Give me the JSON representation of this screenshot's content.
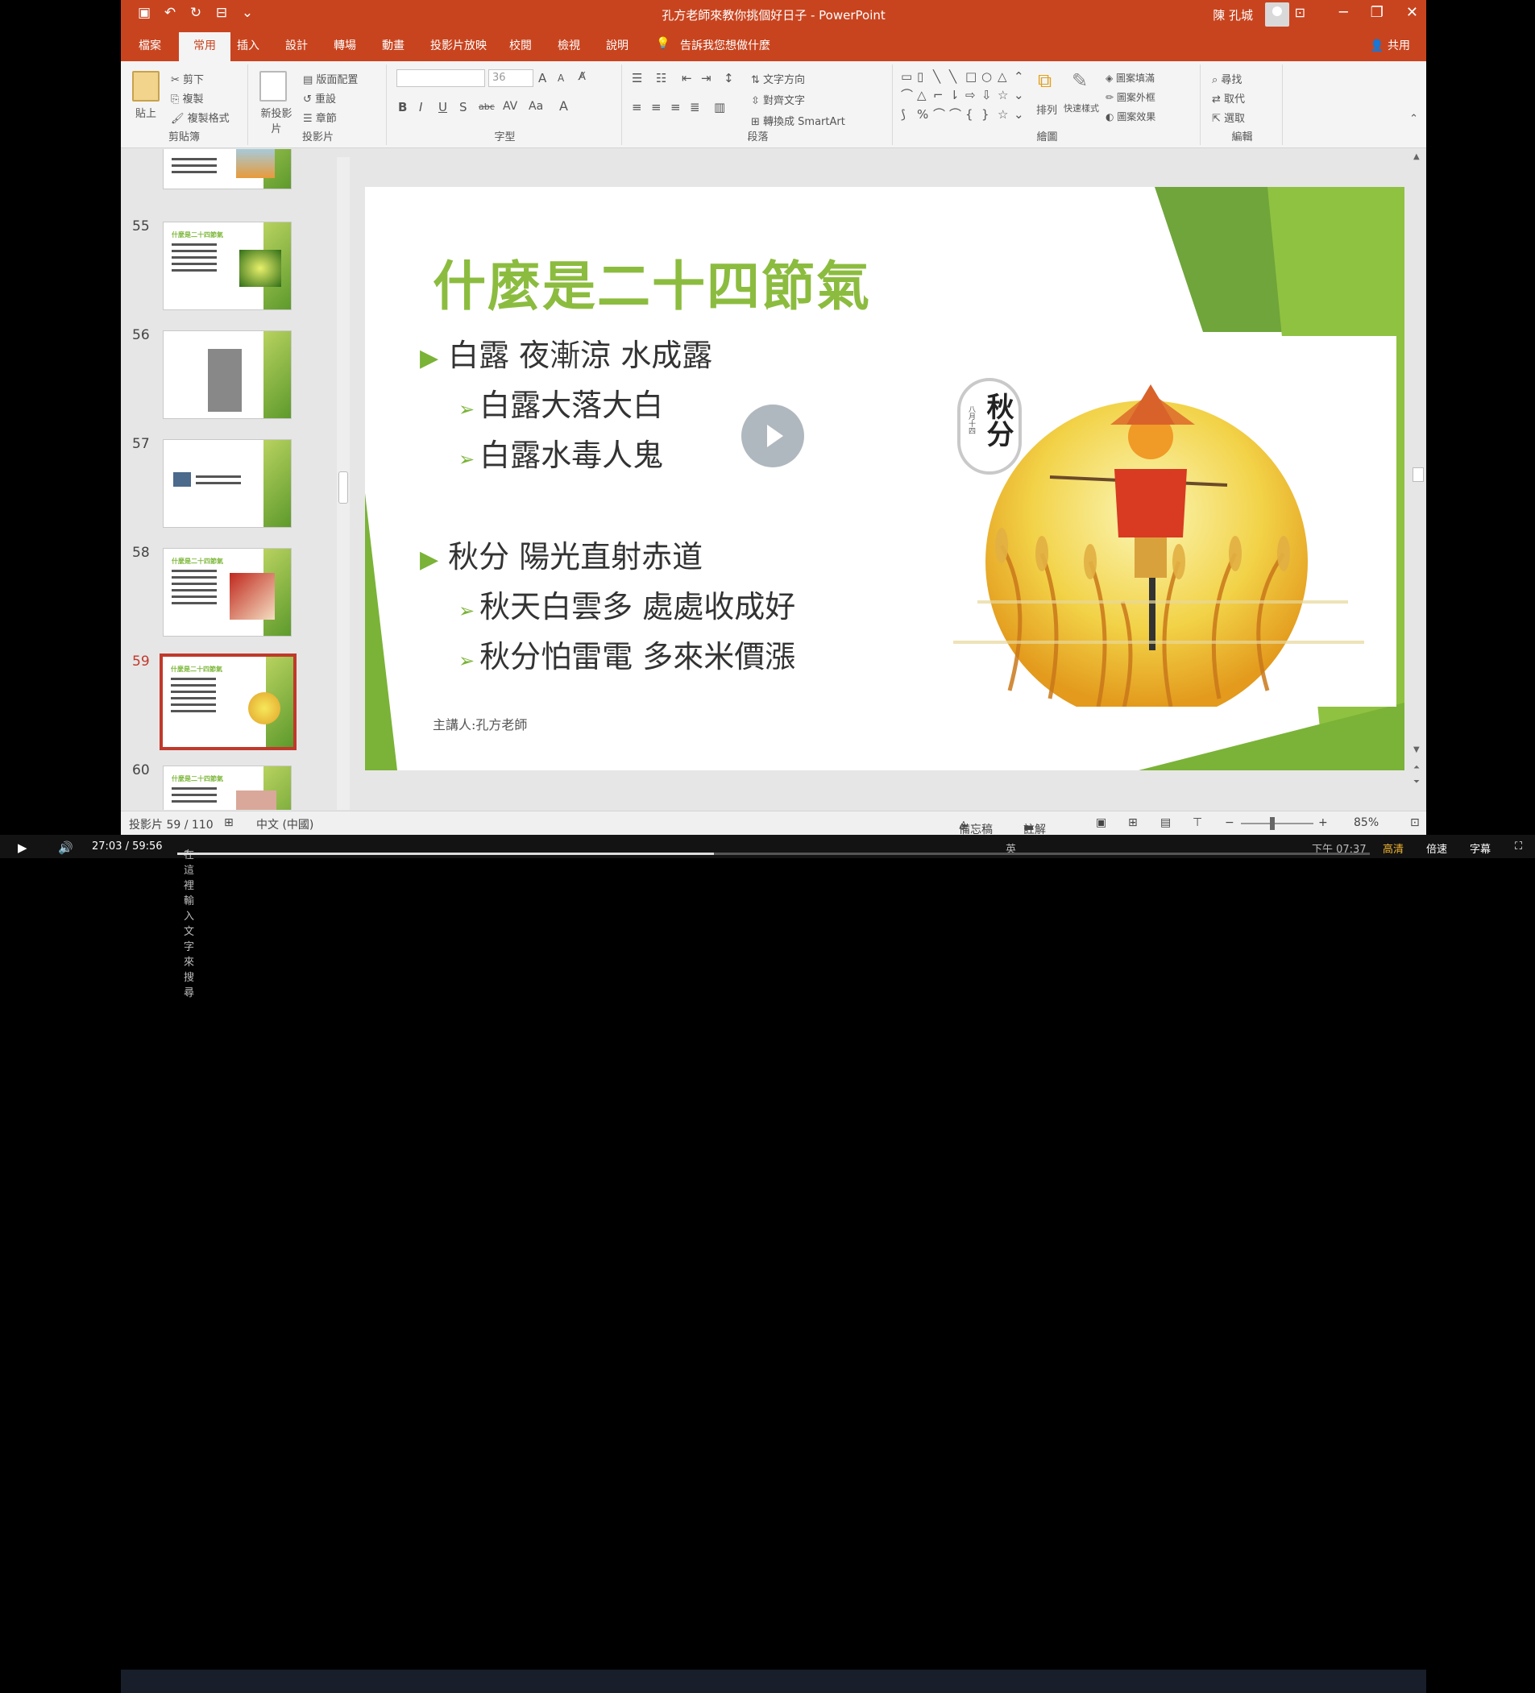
{
  "window": {
    "title": "孔方老師來教你挑個好日子 - PowerPoint",
    "user_name": "陳 孔城"
  },
  "tabs": [
    "檔案",
    "常用",
    "插入",
    "設計",
    "轉場",
    "動畫",
    "投影片放映",
    "校閱",
    "檢視",
    "說明"
  ],
  "active_tab": "常用",
  "tell_me": "告訴我您想做什麼",
  "share": "共用",
  "ribbon": {
    "clipboard": {
      "label": "剪貼簿",
      "paste": "貼上",
      "cut": "剪下",
      "copy": "複製",
      "format_painter": "複製格式"
    },
    "slides": {
      "label": "投影片",
      "new_slide": "新投影片",
      "layout": "版面配置",
      "reset": "重設",
      "section": "章節"
    },
    "font": {
      "label": "字型",
      "size": "36"
    },
    "paragraph": {
      "label": "段落",
      "text_direction": "文字方向",
      "align_text": "對齊文字",
      "smartart": "轉換成 SmartArt"
    },
    "drawing": {
      "label": "繪圖",
      "arrange": "排列",
      "quick_styles": "快速樣式",
      "shape_fill": "圖案填滿",
      "shape_outline": "圖案外框",
      "shape_effects": "圖案效果"
    },
    "editing": {
      "label": "編輯",
      "find": "尋找",
      "replace": "取代",
      "select": "選取"
    }
  },
  "thumbnails": [
    {
      "num": "55",
      "title": "什麼是二十四節氣"
    },
    {
      "num": "56",
      "title": ""
    },
    {
      "num": "57",
      "title": ""
    },
    {
      "num": "58",
      "title": "什麼是二十四節氣"
    },
    {
      "num": "59",
      "title": "什麼是二十四節氣"
    },
    {
      "num": "60",
      "title": "什麼是二十四節氣"
    }
  ],
  "slide": {
    "title": "什麼是二十四節氣",
    "bullet1": "白露 夜漸涼 水成露",
    "sub1a": "白露大落大白",
    "sub1b": "白露水毒人鬼",
    "bullet2": "秋分 陽光直射赤道",
    "sub2a": "秋天白雲多 處處收成好",
    "sub2b": "秋分怕雷電 多來米價漲",
    "presenter": "主講人:孔方老師",
    "stamp_big": "秋分",
    "stamp_small": "八月十四"
  },
  "status": {
    "slide_info": "投影片 59 / 110",
    "language": "中文 (中國)",
    "notes": "備忘稿",
    "comments": "註解",
    "zoom": "85%"
  },
  "player": {
    "time": "27:03 / 59:56",
    "search_placeholder": "在這裡輸入文字來搜尋",
    "quality": "高清",
    "speed": "倍速",
    "subtitle": "字幕",
    "clock": "下午 07:37",
    "ime": "英",
    "progress": 0.45
  },
  "colors": {
    "accent": "#c8441f",
    "slide_green": "#8cbc3f",
    "selected_thumb": "#c0392b"
  }
}
